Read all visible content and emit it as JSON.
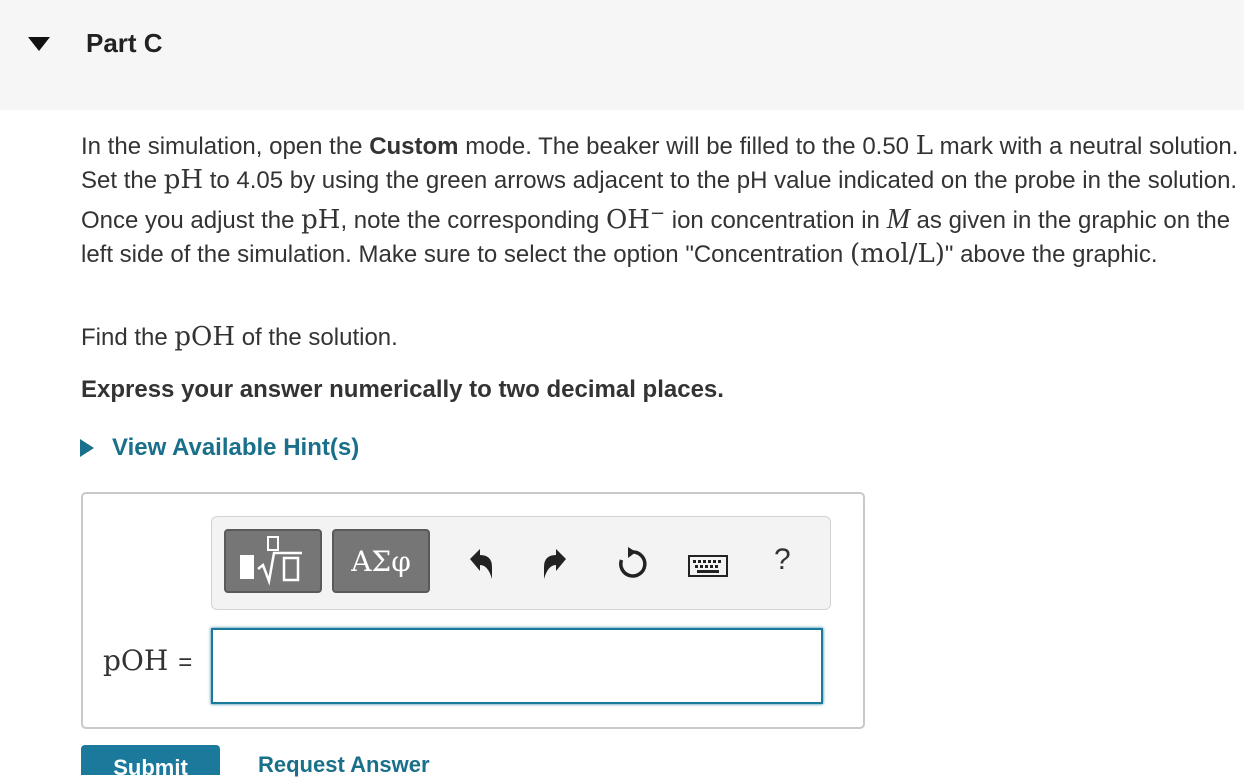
{
  "part": {
    "title": "Part C"
  },
  "problem": {
    "s1": "In the simulation, open the ",
    "custom": "Custom",
    "s2": " mode. The beaker will be filled to the 0.50 ",
    "unit_L": "L",
    "s3": " mark with a neutral solution. Set the ",
    "ph": "pH",
    "s4": " to 4.05 by using the green arrows adjacent to the pH value indicated on the probe in the solution. Once you adjust the ",
    "ph2": "pH",
    "s5": ", note the corresponding ",
    "oh": "OH",
    "oh_sup": "−",
    "s6": " ion concentration in ",
    "m": "M",
    "s7": " as given in the graphic on the left side of the simulation. Make sure to select the option \"Concentration ",
    "conc_unit": "(mol/L)",
    "s8": "\" above the graphic."
  },
  "find": {
    "pre": "Find the ",
    "poh": "pOH",
    "post": " of the solution."
  },
  "instruction": "Express your answer numerically to two decimal places.",
  "hint": {
    "label": "View Available Hint(s)"
  },
  "toolbar": {
    "greek_label": "ΑΣφ",
    "help_label": "?"
  },
  "answer": {
    "label": "pOH",
    "equals": "=",
    "value": ""
  },
  "actions": {
    "submit": "Submit",
    "request": "Request Answer"
  }
}
